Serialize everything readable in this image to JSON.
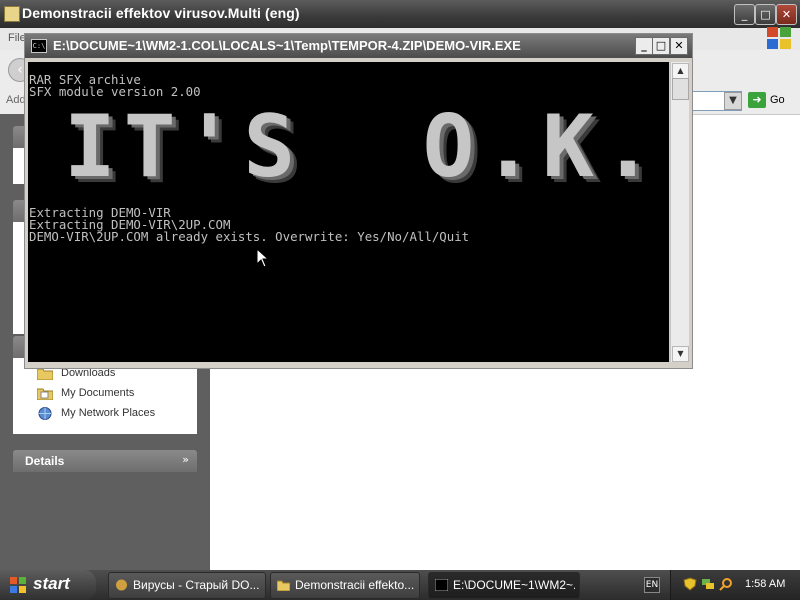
{
  "explorer": {
    "title": "Demonstracii effektov virusov.Multi (eng)",
    "menu": [
      "File"
    ],
    "address_label": "Add",
    "go_label": "Go",
    "title_buttons": {
      "minimize": "_",
      "maximize": "□",
      "close": "✕"
    }
  },
  "task_pane": {
    "places": [
      "Downloads",
      "My Documents",
      "My Network Places"
    ],
    "details_label": "Details",
    "details_chevron": "»"
  },
  "console": {
    "title": "E:\\DOCUME~1\\WM2-1.COL\\LOCALS~1\\Temp\\TEMPOR-4.ZIP\\DEMO-VIR.EXE",
    "icon_text": "C:\\",
    "buttons": {
      "minimize": "_",
      "maximize": "□",
      "close": "✕"
    },
    "lines_top": [
      "RAR SFX archive",
      "SFX module version 2.00"
    ],
    "banner": "IT'S  O.K.",
    "lines_bottom": [
      "Extracting DEMO-VIR",
      "Extracting DEMO-VIR\\2UP.COM",
      "DEMO-VIR\\2UP.COM already exists. Overwrite: Yes/No/All/Quit"
    ]
  },
  "taskbar": {
    "start_label": "start",
    "tasks": [
      {
        "label": "Вирусы - Старый DO...",
        "active": false
      },
      {
        "label": "Demonstracii effekto...",
        "active": false
      },
      {
        "label": "E:\\DOCUME~1\\WM2~...",
        "active": true
      }
    ],
    "language": "EN",
    "clock": "1:58 AM"
  },
  "colors": {
    "console_bg": "#000000",
    "console_text": "#c0c0c0",
    "title_dark": "#3a3a3a"
  }
}
